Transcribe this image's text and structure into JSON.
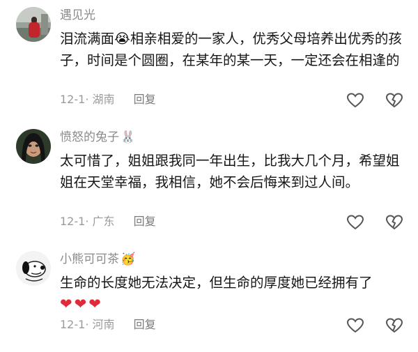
{
  "comments": [
    {
      "user": "遇见光",
      "user_emoji": "",
      "text_prefix": "泪流满面",
      "inline_emoji": "😭",
      "text": "相亲相爱的一家人，优秀父母培养出优秀的孩子，时间是个圆圈，在某年的某一天，一定还会在相逢的",
      "date": "12-1",
      "location": "湖南",
      "reply": "回复"
    },
    {
      "user": "愤怒的兔子",
      "user_emoji": "🐰",
      "text": "太可惜了，姐姐跟我同一年出生，比我大几个月，希望姐姐在天堂幸福，我相信，她不会后悔来到过人间。",
      "date": "12-1",
      "location": "广东",
      "reply": "回复"
    },
    {
      "user": "小熊可可茶",
      "user_emoji": "🥳",
      "text": "生命的长度她无法决定，但生命的厚度她已经拥有了",
      "hearts": "❤❤❤",
      "date": "12-1",
      "location": "河南",
      "reply": "回复"
    }
  ],
  "icons": {
    "like": "heart-outline-icon",
    "dislike": "broken-heart-outline-icon"
  },
  "colors": {
    "text": "#161616",
    "meta": "#9a9a9a",
    "heart": "#e02a3a"
  }
}
